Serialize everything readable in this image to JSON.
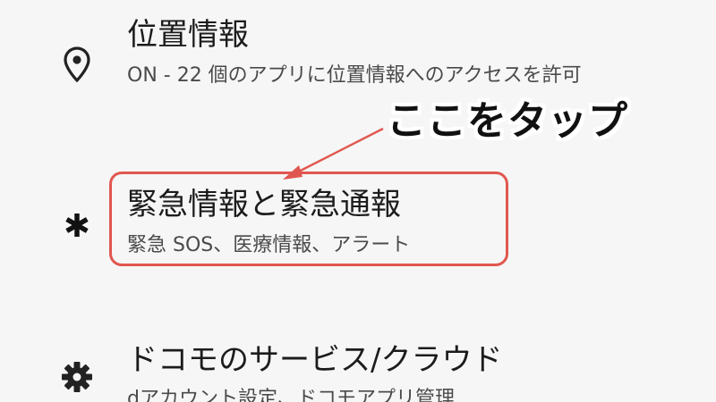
{
  "settings": {
    "items": [
      {
        "title": "位置情報",
        "subtitle": "ON - 22 個のアプリに位置情報へのアクセスを許可",
        "icon": "location-pin-icon"
      },
      {
        "title": "緊急情報と緊急通報",
        "subtitle": "緊急 SOS、医療情報、アラート",
        "icon": "asterisk-icon"
      },
      {
        "title": "ドコモのサービス/クラウド",
        "subtitle": "dアカウント設定、ドコモアプリ管理",
        "icon": "gear-icon"
      }
    ]
  },
  "annotation": {
    "callout_text": "ここをタップ",
    "highlight_color": "#e0574f"
  }
}
